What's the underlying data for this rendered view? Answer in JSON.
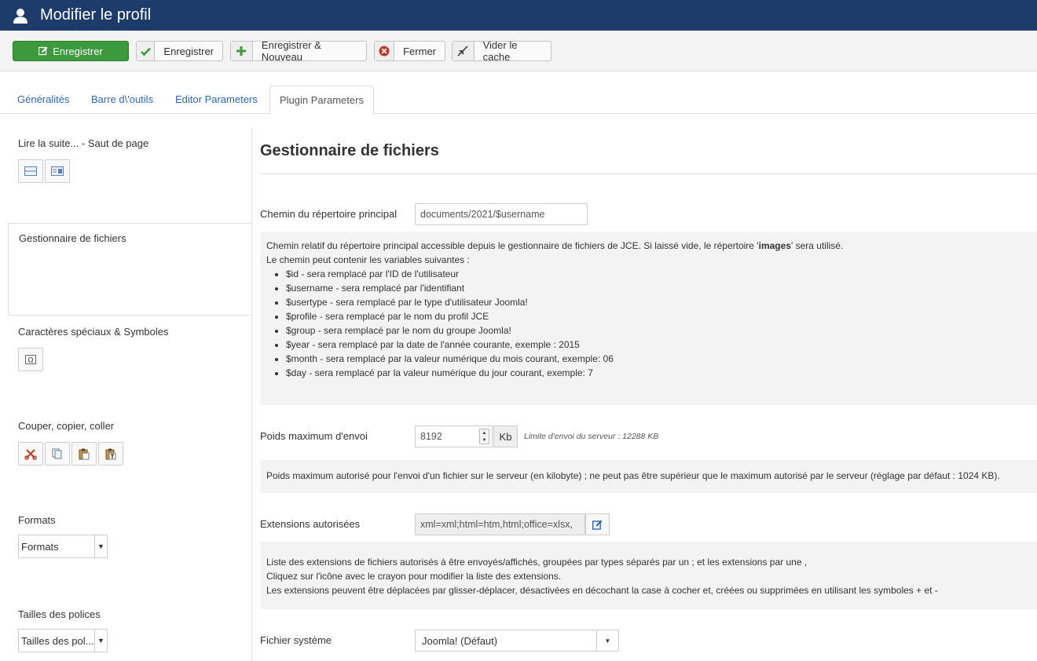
{
  "header": {
    "title": "Modifier le profil"
  },
  "toolbar": {
    "save_primary": "Enregistrer",
    "save": "Enregistrer",
    "save_new": "Enregistrer & Nouveau",
    "close": "Fermer",
    "clear_cache": "Vider le cache"
  },
  "tabs": [
    "Généralités",
    "Barre d\\'outils",
    "Editor Parameters",
    "Plugin Parameters"
  ],
  "sidebar": {
    "readmore": "Lire la suite... - Saut de page",
    "filemanager": "Gestionnaire de fichiers",
    "charmap": "Caractères spéciaux & Symboles",
    "clipboard": "Couper, copier, coller",
    "formats": "Formats",
    "formats_value": "Formats",
    "fontsizes": "Tailles des polices",
    "fontsizes_value": "Tailles des pol..."
  },
  "main": {
    "title": "Gestionnaire de fichiers",
    "dir_label": "Chemin du répertoire principal",
    "dir_value": "documents/2021/$username",
    "dir_desc_1a": "Chemin relatif du répertoire principal accessible depuis le gestionnaire de fichiers de JCE. Si laissé vide, le répertoire '",
    "dir_desc_1b": "images",
    "dir_desc_1c": "' sera utilisé.",
    "dir_desc_2": "Le chemin peut contenir les variables suivantes :",
    "vars": [
      "$id - sera remplacé par l'ID de l'utilisateur",
      "$username - sera remplacé par l'identifiant",
      "$usertype - sera remplacé par le type d'utilisateur Joomla!",
      "$profile - sera remplacé par le nom du profil JCE",
      "$group - sera remplacé par le nom du groupe Joomla!",
      "$year - sera remplacé par la date de l'année courante, exemple : 2015",
      "$month - sera remplacé par la valeur numérique du mois courant, exemple: 06",
      "$day - sera remplacé par la valeur numérique du jour courant, exemple: 7"
    ],
    "upload_label": "Poids maximum d'envoi",
    "upload_value": "8192",
    "upload_unit": "Kb",
    "upload_note": "Limite d'envoi du serveur : 12288 KB",
    "upload_desc": "Poids maximum autorisé pour l'envoi d'un fichier sur le serveur (en kilobyte) ; ne peut pas être supérieur que le maximum autorisé par le serveur (réglage par défaut : 1024 KB).",
    "ext_label": "Extensions autorisées",
    "ext_value": "xml=xml;html=htm,html;office=xlsx,",
    "ext_desc_1": "Liste des extensions de fichiers autorisés à être envoyés/affichés, groupées par types séparés par un ; et les extensions par une ,",
    "ext_desc_2": "Cliquez sur l'icône avec le crayon pour modifier la liste des extensions.",
    "ext_desc_3": "Les extensions peuvent être déplacées par glisser-déplacer, désactivées en décochant la case à cocher et, créées ou supprimées en utilisant les symboles + et -",
    "fs_label": "Fichier système",
    "fs_value": "Joomla! (Défaut)"
  },
  "colors": {
    "header_bg": "#1d3b6b",
    "primary_green": "#3c9a3c",
    "link_blue": "#2a69b8"
  }
}
